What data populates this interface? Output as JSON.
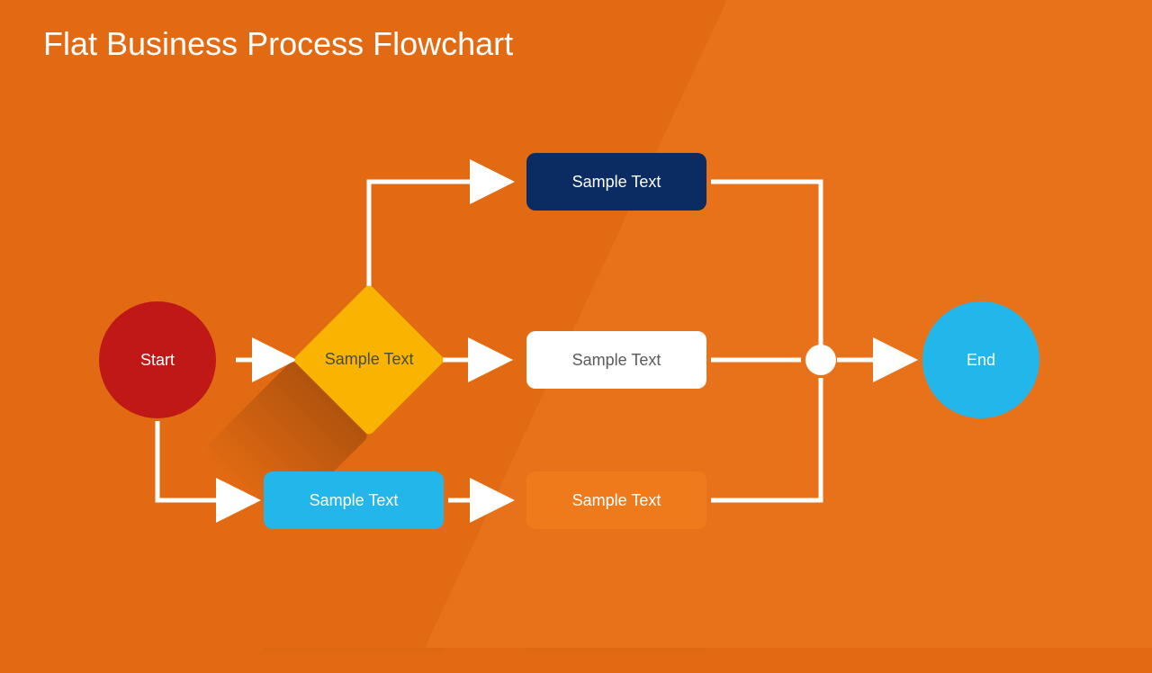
{
  "title": "Flat Business Process Flowchart",
  "nodes": {
    "start": "Start",
    "decision": "Sample Text",
    "box_top": "Sample Text",
    "box_mid": "Sample Text",
    "box_blue": "Sample Text",
    "box_orange": "Sample Text",
    "end": "End"
  },
  "colors": {
    "bg": "#e26a12",
    "start": "#c01717",
    "decision": "#f8b400",
    "navy": "#0b2b63",
    "white": "#ffffff",
    "blue": "#23b6ea",
    "orange": "#ef7a1b"
  }
}
